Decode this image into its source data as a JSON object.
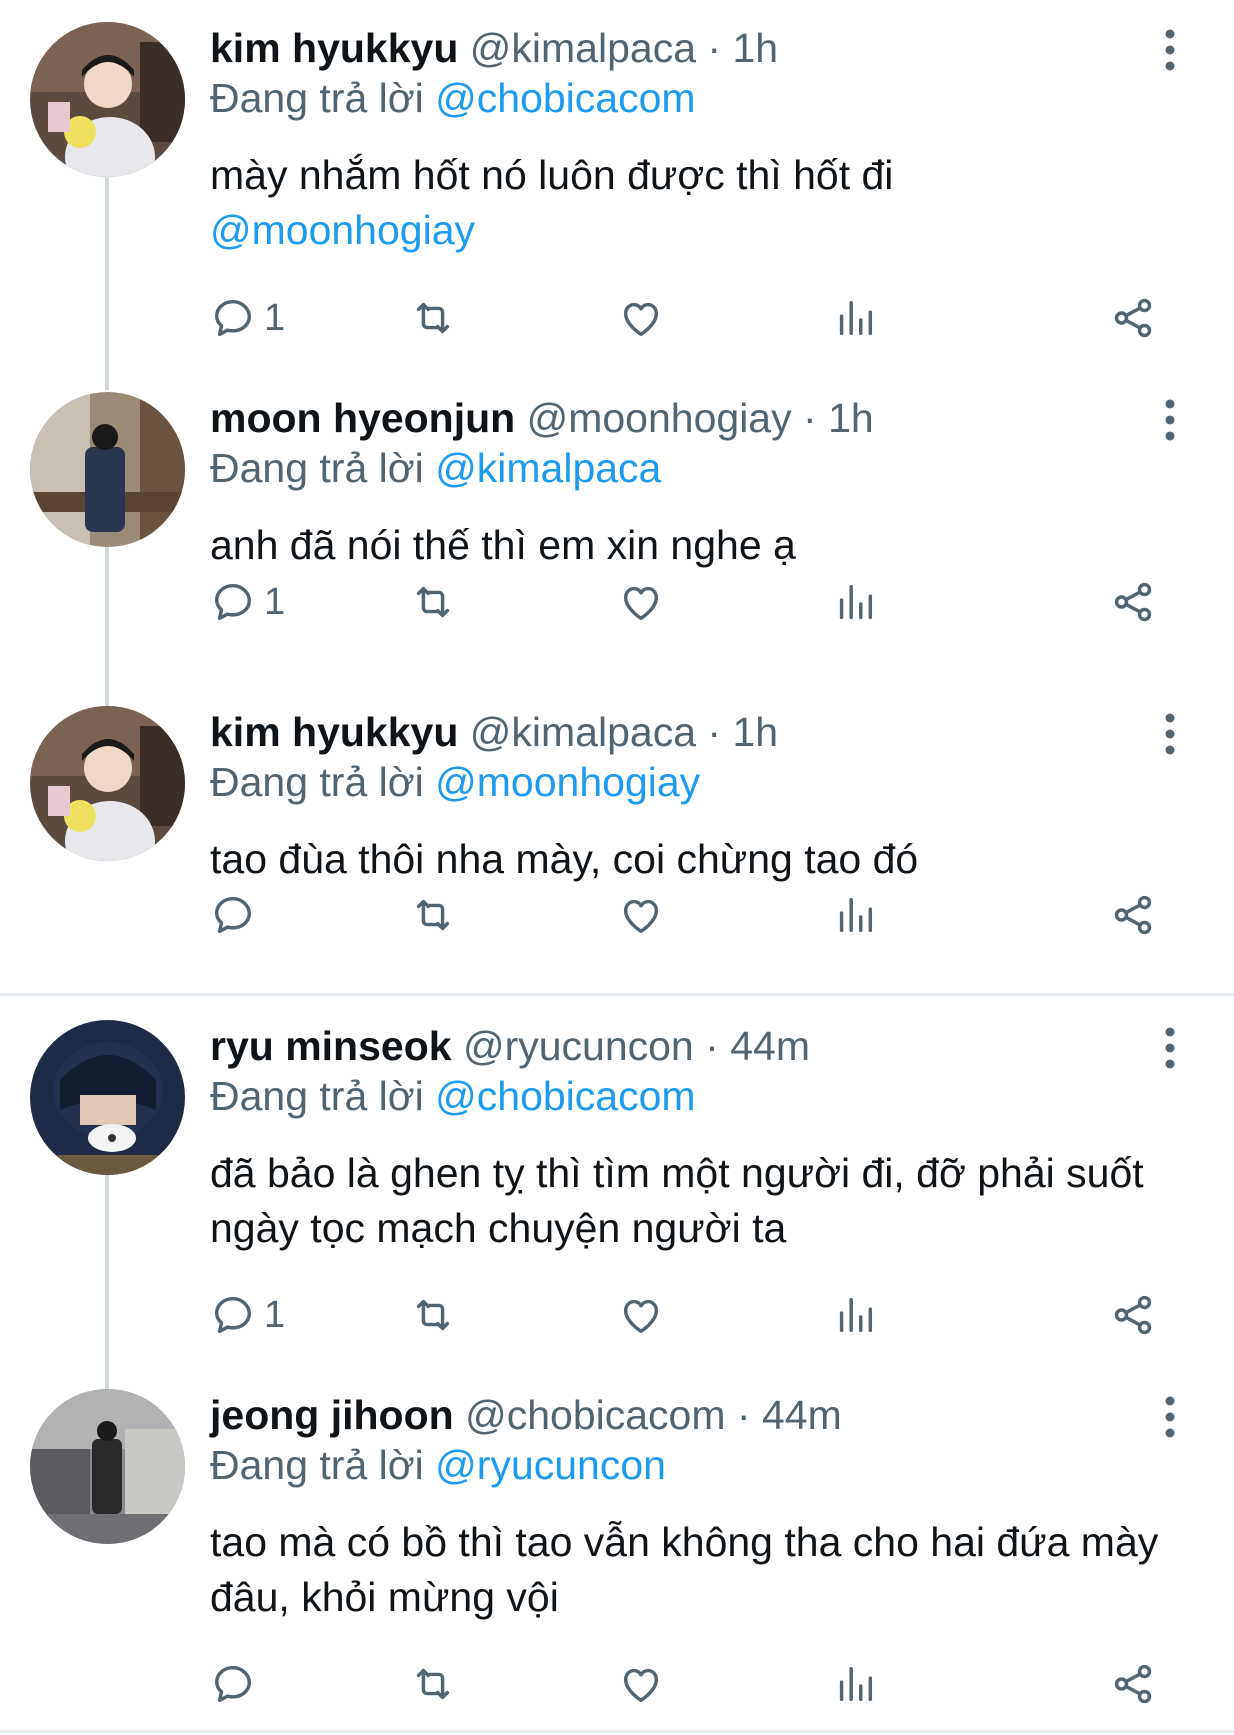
{
  "colors": {
    "accent": "#1d9bf0",
    "muted": "#536471",
    "text": "#0f1419",
    "divider": "#e6ecf0"
  },
  "icons": {
    "reply": "speech-bubble-icon",
    "retweet": "retweet-arrows-icon",
    "like": "heart-icon",
    "views": "bar-chart-icon",
    "share": "share-nodes-icon",
    "more": "vertical-ellipsis-icon"
  },
  "tweets": [
    {
      "name": "kim hyukkyu",
      "handle": "@kimalpaca",
      "separator": "·",
      "time": "1h",
      "reply_prefix": "Đang trả lời",
      "reply_to": "@chobicacom",
      "text": "mày nhắm hốt nó luôn được thì hốt đi",
      "text_mention": "@moonhogiay",
      "reply_count": "1"
    },
    {
      "name": "moon hyeonjun",
      "handle": "@moonhogiay",
      "separator": "·",
      "time": "1h",
      "reply_prefix": "Đang trả lời",
      "reply_to": "@kimalpaca",
      "text": "anh đã nói thế thì em xin nghe ạ",
      "reply_count": "1"
    },
    {
      "name": "kim hyukkyu",
      "handle": "@kimalpaca",
      "separator": "·",
      "time": "1h",
      "reply_prefix": "Đang trả lời",
      "reply_to": "@moonhogiay",
      "text": "tao đùa thôi nha mày, coi chừng tao đó",
      "reply_count": ""
    },
    {
      "name": "ryu minseok",
      "handle": "@ryucuncon",
      "separator": "·",
      "time": "44m",
      "reply_prefix": "Đang trả lời",
      "reply_to": "@chobicacom",
      "text": "đã bảo là ghen tỵ thì tìm một người đi, đỡ phải suốt ngày tọc mạch chuyện người ta",
      "reply_count": "1"
    },
    {
      "name": "jeong jihoon",
      "handle": "@chobicacom",
      "separator": "·",
      "time": "44m",
      "reply_prefix": "Đang trả lời",
      "reply_to": "@ryucuncon",
      "text": "tao mà có bồ thì tao vẫn không tha cho hai đứa mày đâu, khỏi mừng vội",
      "reply_count": ""
    }
  ]
}
